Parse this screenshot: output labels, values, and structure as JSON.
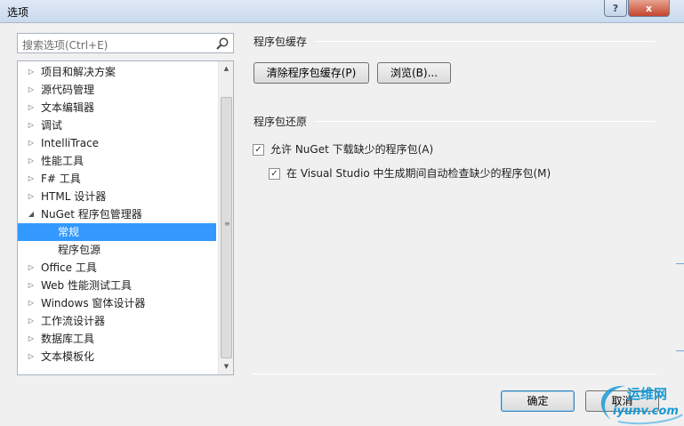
{
  "window": {
    "title": "选项",
    "help_label": "?",
    "close_label": "x"
  },
  "search": {
    "placeholder": "搜索选项(Ctrl+E)"
  },
  "tree": {
    "items": [
      {
        "label": "项目和解决方案",
        "arrow": "▷",
        "child": false,
        "selected": false
      },
      {
        "label": "源代码管理",
        "arrow": "▷",
        "child": false,
        "selected": false
      },
      {
        "label": "文本编辑器",
        "arrow": "▷",
        "child": false,
        "selected": false
      },
      {
        "label": "调试",
        "arrow": "▷",
        "child": false,
        "selected": false
      },
      {
        "label": "IntelliTrace",
        "arrow": "▷",
        "child": false,
        "selected": false
      },
      {
        "label": "性能工具",
        "arrow": "▷",
        "child": false,
        "selected": false
      },
      {
        "label": "F# 工具",
        "arrow": "▷",
        "child": false,
        "selected": false
      },
      {
        "label": "HTML 设计器",
        "arrow": "▷",
        "child": false,
        "selected": false
      },
      {
        "label": "NuGet 程序包管理器",
        "arrow": "◢",
        "child": false,
        "selected": false
      },
      {
        "label": "常规",
        "arrow": "",
        "child": true,
        "selected": true
      },
      {
        "label": "程序包源",
        "arrow": "",
        "child": true,
        "selected": false
      },
      {
        "label": "Office 工具",
        "arrow": "▷",
        "child": false,
        "selected": false
      },
      {
        "label": "Web 性能测试工具",
        "arrow": "▷",
        "child": false,
        "selected": false
      },
      {
        "label": "Windows 窗体设计器",
        "arrow": "▷",
        "child": false,
        "selected": false
      },
      {
        "label": "工作流设计器",
        "arrow": "▷",
        "child": false,
        "selected": false
      },
      {
        "label": "数据库工具",
        "arrow": "▷",
        "child": false,
        "selected": false
      },
      {
        "label": "文本模板化",
        "arrow": "▷",
        "child": false,
        "selected": false
      }
    ]
  },
  "cache_section": {
    "title": "程序包缓存",
    "clear_button": "清除程序包缓存(P)",
    "browse_button": "浏览(B)..."
  },
  "restore_section": {
    "title": "程序包还原",
    "allow_download": {
      "label": "允许 NuGet 下载缺少的程序包(A)",
      "checked": true
    },
    "auto_check": {
      "label": "在 Visual Studio 中生成期间自动检查缺少的程序包(M)",
      "checked": true
    }
  },
  "footer": {
    "ok_button": "确定",
    "cancel_button": "取消"
  },
  "watermark": {
    "line1": "运维网",
    "line2": "iyunv.com"
  },
  "colors": {
    "selection": "#3399ff",
    "watermark": "#1a9ad6"
  }
}
